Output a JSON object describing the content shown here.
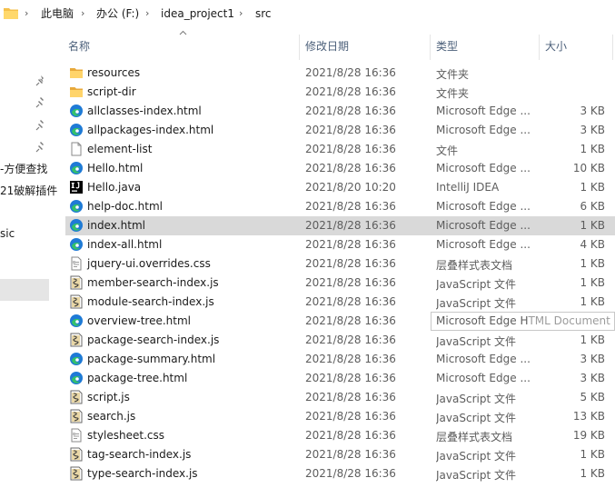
{
  "breadcrumb": {
    "items": [
      "此电脑",
      "办公 (F:)",
      "idea_project1",
      "src"
    ],
    "separator": "›"
  },
  "nav": {
    "pin_count": 4,
    "texts": [
      "-方便查找",
      "21破解插件",
      "sic"
    ]
  },
  "columns": {
    "name": "名称",
    "date": "修改日期",
    "type": "类型",
    "size": "大小"
  },
  "files": [
    {
      "name": "resources",
      "date": "2021/8/28 16:36",
      "type": "文件夹",
      "size": "",
      "icon": "folder-icon"
    },
    {
      "name": "script-dir",
      "date": "2021/8/28 16:36",
      "type": "文件夹",
      "size": "",
      "icon": "folder-icon"
    },
    {
      "name": "allclasses-index.html",
      "date": "2021/8/28 16:36",
      "type": "Microsoft Edge ...",
      "size": "3 KB",
      "icon": "edge-icon"
    },
    {
      "name": "allpackages-index.html",
      "date": "2021/8/28 16:36",
      "type": "Microsoft Edge ...",
      "size": "3 KB",
      "icon": "edge-icon"
    },
    {
      "name": "element-list",
      "date": "2021/8/28 16:36",
      "type": "文件",
      "size": "1 KB",
      "icon": "file-icon"
    },
    {
      "name": "Hello.html",
      "date": "2021/8/28 16:36",
      "type": "Microsoft Edge ...",
      "size": "10 KB",
      "icon": "edge-icon"
    },
    {
      "name": "Hello.java",
      "date": "2021/8/20 10:20",
      "type": "IntelliJ IDEA",
      "size": "1 KB",
      "icon": "intellij-icon"
    },
    {
      "name": "help-doc.html",
      "date": "2021/8/28 16:36",
      "type": "Microsoft Edge ...",
      "size": "6 KB",
      "icon": "edge-icon"
    },
    {
      "name": "index.html",
      "date": "2021/8/28 16:36",
      "type": "Microsoft Edge ...",
      "size": "1 KB",
      "icon": "edge-icon",
      "selected": true
    },
    {
      "name": "index-all.html",
      "date": "2021/8/28 16:36",
      "type": "Microsoft Edge ...",
      "size": "4 KB",
      "icon": "edge-icon"
    },
    {
      "name": "jquery-ui.overrides.css",
      "date": "2021/8/28 16:36",
      "type": "层叠样式表文档",
      "size": "1 KB",
      "icon": "css-icon"
    },
    {
      "name": "member-search-index.js",
      "date": "2021/8/28 16:36",
      "type": "JavaScript 文件",
      "size": "1 KB",
      "icon": "js-icon"
    },
    {
      "name": "module-search-index.js",
      "date": "2021/8/28 16:36",
      "type": "JavaScript 文件",
      "size": "1 KB",
      "icon": "js-icon"
    },
    {
      "name": "overview-tree.html",
      "date": "2021/8/28 16:36",
      "type": "",
      "size": "",
      "icon": "edge-icon"
    },
    {
      "name": "package-search-index.js",
      "date": "2021/8/28 16:36",
      "type": "JavaScript 文件",
      "size": "1 KB",
      "icon": "js-icon"
    },
    {
      "name": "package-summary.html",
      "date": "2021/8/28 16:36",
      "type": "Microsoft Edge ...",
      "size": "3 KB",
      "icon": "edge-icon"
    },
    {
      "name": "package-tree.html",
      "date": "2021/8/28 16:36",
      "type": "Microsoft Edge ...",
      "size": "3 KB",
      "icon": "edge-icon"
    },
    {
      "name": "script.js",
      "date": "2021/8/28 16:36",
      "type": "JavaScript 文件",
      "size": "5 KB",
      "icon": "js-icon"
    },
    {
      "name": "search.js",
      "date": "2021/8/28 16:36",
      "type": "JavaScript 文件",
      "size": "13 KB",
      "icon": "js-icon"
    },
    {
      "name": "stylesheet.css",
      "date": "2021/8/28 16:36",
      "type": "层叠样式表文档",
      "size": "19 KB",
      "icon": "css-icon"
    },
    {
      "name": "tag-search-index.js",
      "date": "2021/8/28 16:36",
      "type": "JavaScript 文件",
      "size": "1 KB",
      "icon": "js-icon"
    },
    {
      "name": "type-search-index.js",
      "date": "2021/8/28 16:36",
      "type": "JavaScript 文件",
      "size": "1 KB",
      "icon": "js-icon"
    }
  ],
  "tooltip": {
    "text_main": "Microsoft Edge H",
    "text_faded": "TML Document"
  },
  "colors": {
    "selected_row": "#d9d9d9",
    "header_text": "#4c607a",
    "folder": "#f5c04a",
    "edge_blue": "#1f7ad6",
    "edge_green": "#34c26a"
  }
}
